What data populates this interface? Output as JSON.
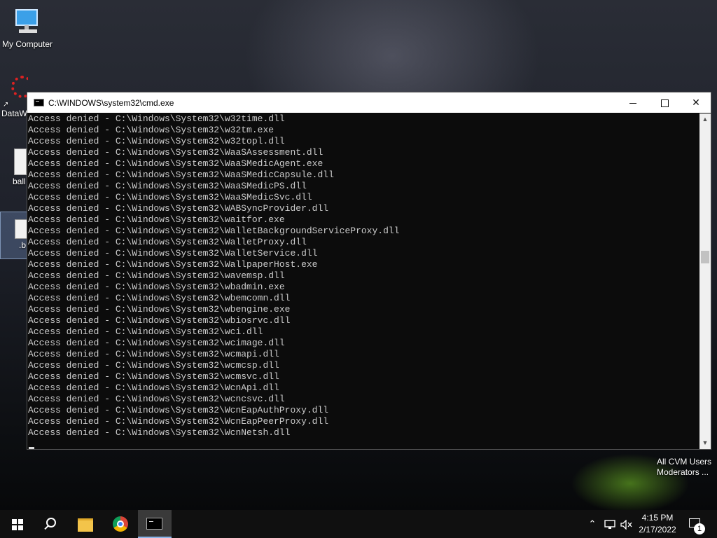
{
  "desktop": {
    "icons": [
      {
        "label": "My Computer"
      },
      {
        "label": "DataW"
      },
      {
        "label": "ball"
      },
      {
        "label": ".b"
      }
    ],
    "watermark_lines": [
      "All CVM Users",
      "Moderators ..."
    ]
  },
  "cmd_window": {
    "title": "C:\\WINDOWS\\system32\\cmd.exe",
    "lines": [
      "Access denied - C:\\Windows\\System32\\w32time.dll",
      "Access denied - C:\\Windows\\System32\\w32tm.exe",
      "Access denied - C:\\Windows\\System32\\w32topl.dll",
      "Access denied - C:\\Windows\\System32\\WaaSAssessment.dll",
      "Access denied - C:\\Windows\\System32\\WaaSMedicAgent.exe",
      "Access denied - C:\\Windows\\System32\\WaaSMedicCapsule.dll",
      "Access denied - C:\\Windows\\System32\\WaaSMedicPS.dll",
      "Access denied - C:\\Windows\\System32\\WaaSMedicSvc.dll",
      "Access denied - C:\\Windows\\System32\\WABSyncProvider.dll",
      "Access denied - C:\\Windows\\System32\\waitfor.exe",
      "Access denied - C:\\Windows\\System32\\WalletBackgroundServiceProxy.dll",
      "Access denied - C:\\Windows\\System32\\WalletProxy.dll",
      "Access denied - C:\\Windows\\System32\\WalletService.dll",
      "Access denied - C:\\Windows\\System32\\WallpaperHost.exe",
      "Access denied - C:\\Windows\\System32\\wavemsp.dll",
      "Access denied - C:\\Windows\\System32\\wbadmin.exe",
      "Access denied - C:\\Windows\\System32\\wbemcomn.dll",
      "Access denied - C:\\Windows\\System32\\wbengine.exe",
      "Access denied - C:\\Windows\\System32\\wbiosrvc.dll",
      "Access denied - C:\\Windows\\System32\\wci.dll",
      "Access denied - C:\\Windows\\System32\\wcimage.dll",
      "Access denied - C:\\Windows\\System32\\wcmapi.dll",
      "Access denied - C:\\Windows\\System32\\wcmcsp.dll",
      "Access denied - C:\\Windows\\System32\\wcmsvc.dll",
      "Access denied - C:\\Windows\\System32\\WcnApi.dll",
      "Access denied - C:\\Windows\\System32\\wcncsvc.dll",
      "Access denied - C:\\Windows\\System32\\WcnEapAuthProxy.dll",
      "Access denied - C:\\Windows\\System32\\WcnEapPeerProxy.dll",
      "Access denied - C:\\Windows\\System32\\WcnNetsh.dll"
    ],
    "colors": {
      "background": "#0c0c0c",
      "text": "#cccccc"
    }
  },
  "taskbar": {
    "apps": [
      "start-icon",
      "search-icon",
      "file-explorer-icon",
      "chrome-icon",
      "cmd-icon"
    ],
    "clock": {
      "time": "4:15 PM",
      "date": "2/17/2022"
    },
    "notification_count": "1",
    "tray_icons": [
      "chevron-up-icon",
      "network-icon",
      "volume-muted-icon"
    ]
  }
}
